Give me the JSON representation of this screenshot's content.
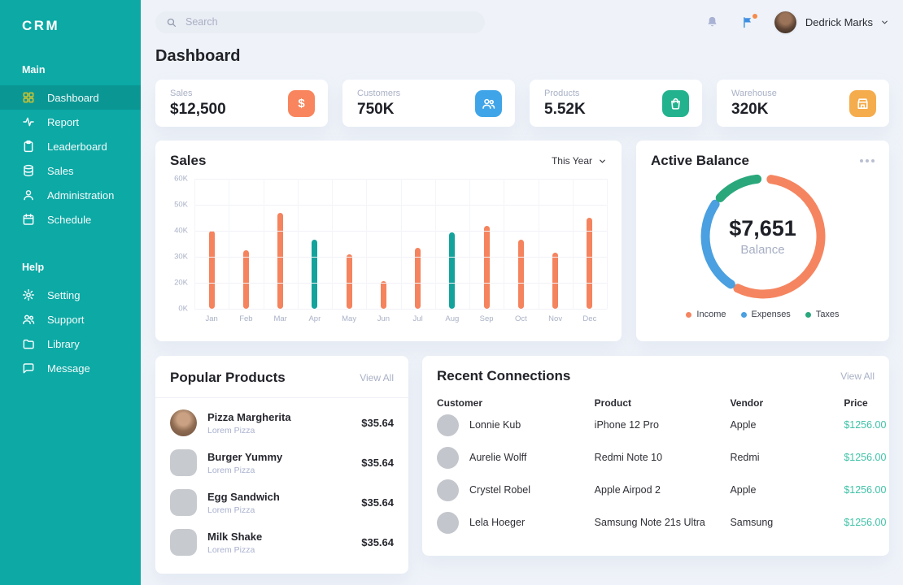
{
  "app": {
    "logo": "CRM"
  },
  "sidebar": {
    "sections": [
      {
        "label": "Main",
        "items": [
          {
            "label": "Dashboard",
            "icon": "dashboard-grid-icon",
            "active": true
          },
          {
            "label": "Report",
            "icon": "activity-icon",
            "active": false
          },
          {
            "label": "Leaderboard",
            "icon": "clipboard-icon",
            "active": false
          },
          {
            "label": "Sales",
            "icon": "database-icon",
            "active": false
          },
          {
            "label": "Administration",
            "icon": "user-icon",
            "active": false
          },
          {
            "label": "Schedule",
            "icon": "calendar-icon",
            "active": false
          }
        ]
      },
      {
        "label": "Help",
        "items": [
          {
            "label": "Setting",
            "icon": "gear-icon",
            "active": false
          },
          {
            "label": "Support",
            "icon": "users-icon",
            "active": false
          },
          {
            "label": "Library",
            "icon": "folder-icon",
            "active": false
          },
          {
            "label": "Message",
            "icon": "chat-icon",
            "active": false
          }
        ]
      }
    ]
  },
  "topbar": {
    "search_placeholder": "Search",
    "user_name": "Dedrick Marks",
    "icons": [
      "bell-icon",
      "flag-icon"
    ],
    "flag_badge_color": "#f58a4b"
  },
  "page": {
    "title": "Dashboard"
  },
  "stats": [
    {
      "label": "Sales",
      "value": "$12,500",
      "icon": "dollar-icon",
      "color": "#f8855d"
    },
    {
      "label": "Customers",
      "value": "750K",
      "icon": "users-icon",
      "color": "#3fa5e8"
    },
    {
      "label": "Products",
      "value": "5.52K",
      "icon": "bag-icon",
      "color": "#23b28e"
    },
    {
      "label": "Warehouse",
      "value": "320K",
      "icon": "store-icon",
      "color": "#f5ac4d"
    }
  ],
  "chart_data": [
    {
      "type": "bar",
      "title": "Sales",
      "range_selector": "This Year",
      "categories": [
        "Jan",
        "Feb",
        "Mar",
        "Apr",
        "May",
        "Jun",
        "Jul",
        "Aug",
        "Sep",
        "Oct",
        "Nov",
        "Dec"
      ],
      "values_k": [
        40,
        32,
        47,
        36,
        31,
        20,
        34,
        40,
        42,
        37,
        32,
        45
      ],
      "heights_pct": [
        60,
        45,
        74,
        53,
        42,
        21,
        47,
        59,
        64,
        53,
        43,
        70
      ],
      "bar_color": "#f4835e",
      "highlight_color": "#14a29c",
      "highlight_indices": [
        3,
        7
      ],
      "ylabels": [
        "60K",
        "50K",
        "40K",
        "30K",
        "20K",
        "0K"
      ],
      "ylim": [
        0,
        60
      ],
      "grid": true
    },
    {
      "type": "donut",
      "title": "Active Balance",
      "menu_icon": "more-horizontal-icon",
      "center_value": "$7,651",
      "center_label": "Balance",
      "segments": [
        {
          "name": "Income",
          "pct": 55,
          "color": "#f58560",
          "start_deg": 8,
          "end_deg": 206
        },
        {
          "name": "Expenses",
          "pct": 25,
          "color": "#4aa0e0",
          "start_deg": 214,
          "end_deg": 304
        },
        {
          "name": "Taxes",
          "pct": 12,
          "color": "#2aa87c",
          "start_deg": 312,
          "end_deg": 354
        }
      ],
      "legend_position": "bottom"
    }
  ],
  "popular_products": {
    "title": "Popular Products",
    "view_all": "View All",
    "items": [
      {
        "name": "Pizza Margherita",
        "subtitle": "Lorem Pizza",
        "price": "$35.64",
        "image": "photo"
      },
      {
        "name": "Burger Yummy",
        "subtitle": "Lorem Pizza",
        "price": "$35.64",
        "image": "placeholder"
      },
      {
        "name": "Egg Sandwich",
        "subtitle": "Lorem Pizza",
        "price": "$35.64",
        "image": "placeholder"
      },
      {
        "name": "Milk Shake",
        "subtitle": "Lorem Pizza",
        "price": "$35.64",
        "image": "placeholder"
      }
    ]
  },
  "recent_connections": {
    "title": "Recent Connections",
    "view_all": "View All",
    "columns": [
      "Customer",
      "Product",
      "Vendor",
      "Price"
    ],
    "price_color": "#3fc2a7",
    "rows": [
      {
        "customer": "Lonnie Kub",
        "product": "iPhone 12 Pro",
        "vendor": "Apple",
        "price": "$1256.00"
      },
      {
        "customer": "Aurelie Wolff",
        "product": "Redmi Note 10",
        "vendor": "Redmi",
        "price": "$1256.00"
      },
      {
        "customer": "Crystel Robel",
        "product": "Apple Airpod 2",
        "vendor": "Apple",
        "price": "$1256.00"
      },
      {
        "customer": "Lela Hoeger",
        "product": "Samsung Note 21s Ultra",
        "vendor": "Samsung",
        "price": "$1256.00"
      }
    ]
  }
}
